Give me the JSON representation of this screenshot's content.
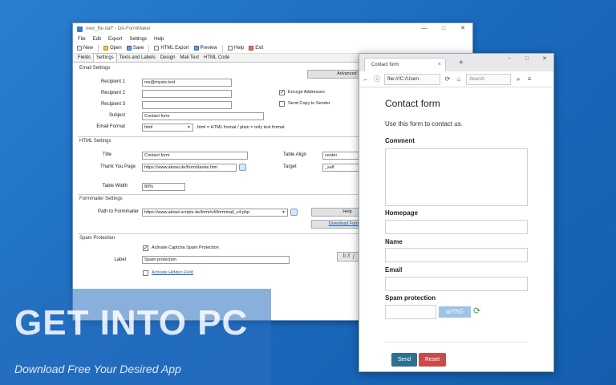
{
  "app": {
    "title": "new_file.daf* - DA-FormMaker",
    "menu": [
      "File",
      "Edit",
      "Export",
      "Settings",
      "Help"
    ],
    "toolbar": [
      "New",
      "Open",
      "Save",
      "HTML Export",
      "Preview",
      "Help",
      "Exit"
    ],
    "tabs": [
      "Fields",
      "Settings",
      "Texts and Labels",
      "Design",
      "Mail Text",
      "HTML Code"
    ],
    "active_tab": "Settings",
    "email": {
      "section": "Email Settings",
      "recipient1_label": "Recipient 1",
      "recipient1_value": "me@myste.test",
      "recipient2_label": "Recipient 2",
      "recipient3_label": "Recipient 3",
      "subject_label": "Subject",
      "subject_value": "Contact form",
      "format_label": "Email Format",
      "format_value": "html",
      "format_note": "html = HTML format / plain = only text format",
      "advanced_button": "Advanced Sett",
      "encrypt_label": "Encrypt Addresses",
      "copy_label": "Send Copy to Sender"
    },
    "html": {
      "section": "HTML Settings",
      "title_label": "Title",
      "title_value": "Contact form",
      "thanks_label": "Thank You Page",
      "thanks_value": "https://www.akowi.de/form/danke.htm",
      "width_label": "Table Width",
      "width_value": "80%",
      "align_label": "Table Align",
      "align_value": "center",
      "target_label": "Target",
      "target_value": "_self"
    },
    "formmailer": {
      "section": "Formmailer Settings",
      "path_label": "Path to Formmailer",
      "path_value": "https://www.akowi-scripts.de/form/v4/formmail_v4.php",
      "help_button": "Help",
      "download_link": "Download Formma"
    },
    "spam": {
      "section": "Spam Protection",
      "activate_label": "Activate Captcha Spam Protection",
      "label_label": "Label",
      "label_value": "Spam protection",
      "hidden_link": "Activate Hidden Field",
      "captcha_text": "b3 j"
    }
  },
  "browser": {
    "tab_title": "Contact form",
    "tab_close": "×",
    "new_tab": "+",
    "url": "file:///C:/Usen",
    "search_placeholder": "Search",
    "controls": [
      "−",
      "□",
      "✕"
    ],
    "nav": [
      "←",
      "ⓘ",
      "⟳",
      "⌂",
      "»",
      "≡"
    ]
  },
  "form": {
    "title": "Contact form",
    "description": "Use this form to contact us.",
    "comment_label": "Comment",
    "homepage_label": "Homepage",
    "name_label": "Name",
    "email_label": "Email",
    "spam_label": "Spam protection",
    "captcha_text": "wYhG",
    "send_button": "Send",
    "reset_button": "Reset"
  },
  "watermark": {
    "title": "GET INTO PC",
    "subtitle": "Download Free Your Desired App"
  },
  "window_controls": [
    "—",
    "□",
    "✕"
  ]
}
